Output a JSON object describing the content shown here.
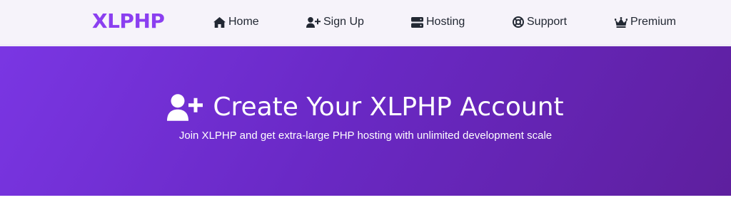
{
  "brand": {
    "name": "XLPHP"
  },
  "nav": {
    "items": [
      {
        "label": "Home",
        "icon": "home-icon"
      },
      {
        "label": "Sign Up",
        "icon": "user-plus-icon"
      },
      {
        "label": "Hosting",
        "icon": "server-icon"
      },
      {
        "label": "Support",
        "icon": "life-ring-icon"
      },
      {
        "label": "Premium",
        "icon": "crown-icon"
      }
    ]
  },
  "hero": {
    "icon": "user-plus-icon",
    "title": "Create Your XLPHP Account",
    "subtitle": "Join XLPHP and get extra-large PHP hosting with unlimited development scale"
  },
  "colors": {
    "brand": "#8b3ff0",
    "navbar_bg": "#f6f3fa",
    "hero_gradient_start": "#7a36e3",
    "hero_gradient_end": "#5e1f9e",
    "nav_text": "#222833"
  }
}
